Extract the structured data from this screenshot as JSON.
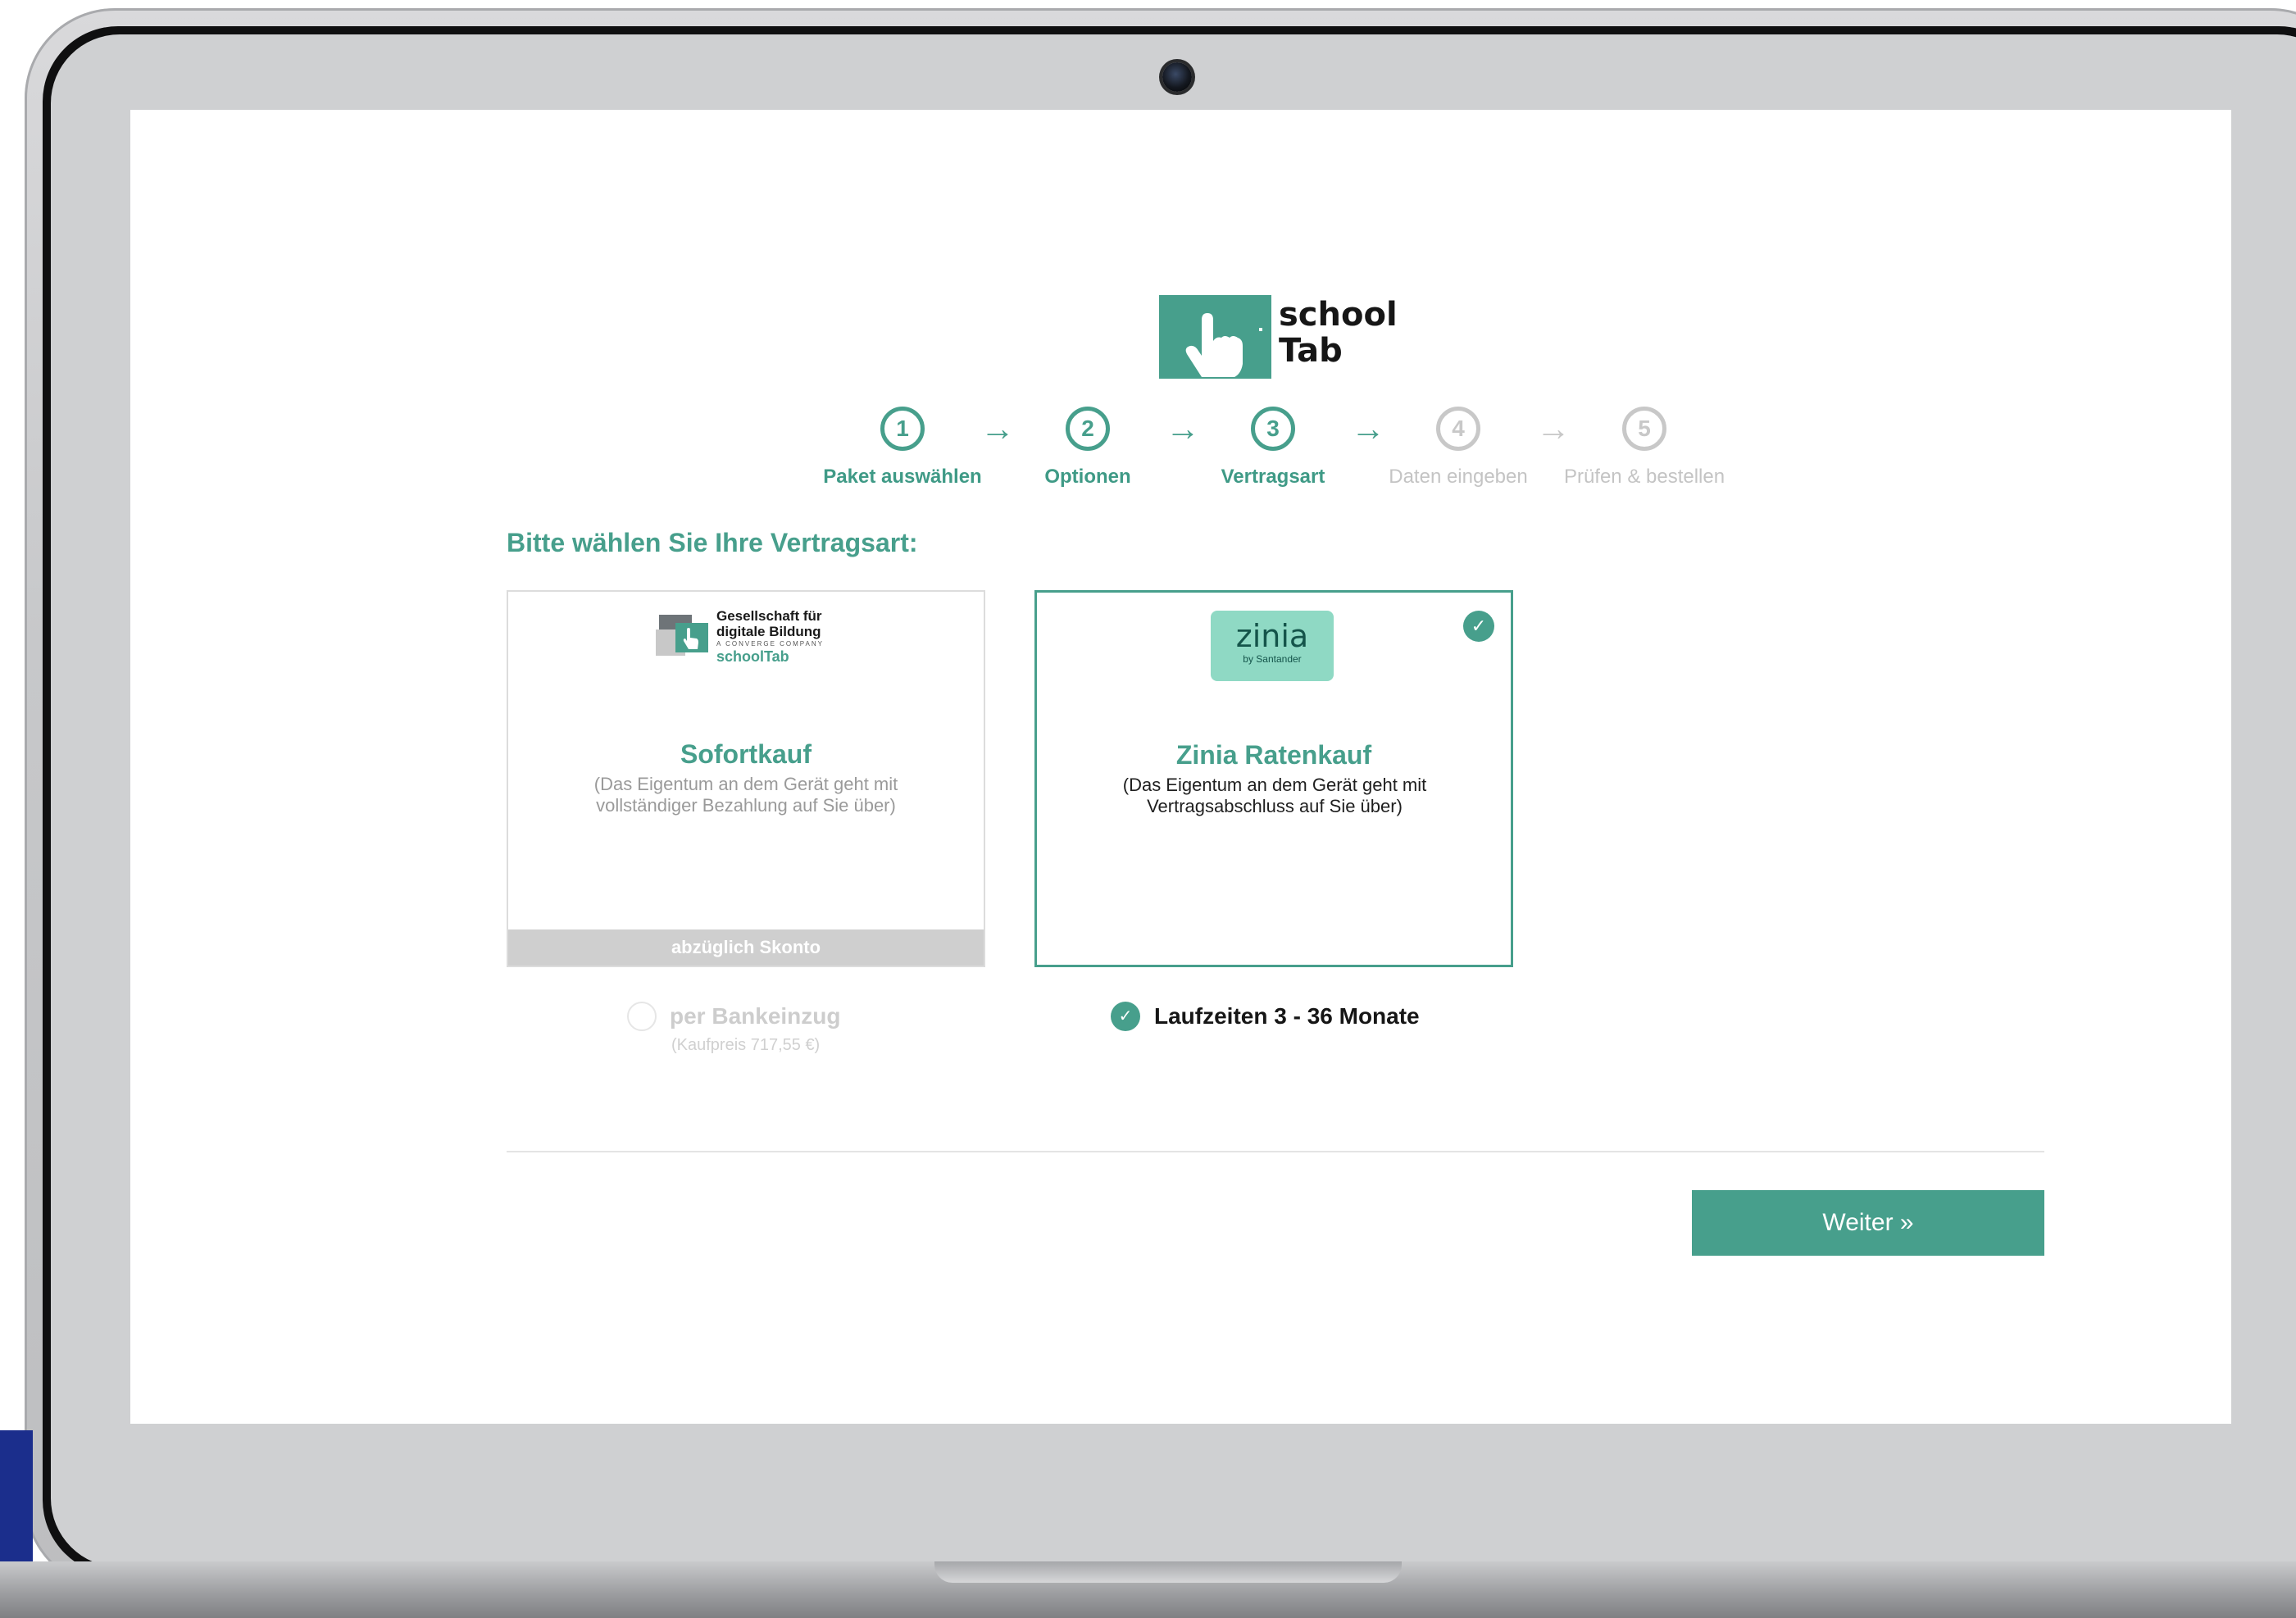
{
  "logo": {
    "line1": "school",
    "line2": "Tab"
  },
  "steps": [
    {
      "number": "1",
      "label": "Paket auswählen",
      "state": "done"
    },
    {
      "number": "2",
      "label": "Optionen",
      "state": "done"
    },
    {
      "number": "3",
      "label": "Vertragsart",
      "state": "current"
    },
    {
      "number": "4",
      "label": "Daten eingeben",
      "state": "upcoming"
    },
    {
      "number": "5",
      "label": "Prüfen & bestellen",
      "state": "upcoming"
    }
  ],
  "arrow_glyph": "→",
  "headline": "Bitte wählen Sie Ihre Vertragsart:",
  "cards": {
    "sofortkauf": {
      "logo_line1": "Gesellschaft für",
      "logo_line2": "digitale Bildung",
      "logo_line3": "A CONVERGE COMPANY",
      "logo_line4": "schoolTab",
      "title": "Sofortkauf",
      "desc_line1": "(Das Eigentum an dem Gerät geht mit",
      "desc_line2": "vollständiger Bezahlung auf Sie über)",
      "footer": "abzüglich Skonto",
      "selected": false
    },
    "zinia": {
      "logo_word": "zinia",
      "logo_sub": "by Santander",
      "title": "Zinia Ratenkauf",
      "desc_line1": "(Das Eigentum an dem Gerät geht mit",
      "desc_line2": "Vertragsabschluss auf Sie über)",
      "selected": true
    }
  },
  "options": {
    "bankeinzug": {
      "label": "per Bankeinzug",
      "sub": "(Kaufpreis 717,55 €)",
      "checked": false
    },
    "laufzeiten": {
      "label": "Laufzeiten 3 - 36 Monate",
      "checked": true
    }
  },
  "next_button": "Weiter »",
  "colors": {
    "accent": "#479f8c",
    "inactive": "#c8c8c8",
    "zinia_badge": "#8fd9c4",
    "frame": "#c7c8ca"
  },
  "icons": {
    "check": "check-icon",
    "step_arrow": "arrow-right-icon"
  }
}
